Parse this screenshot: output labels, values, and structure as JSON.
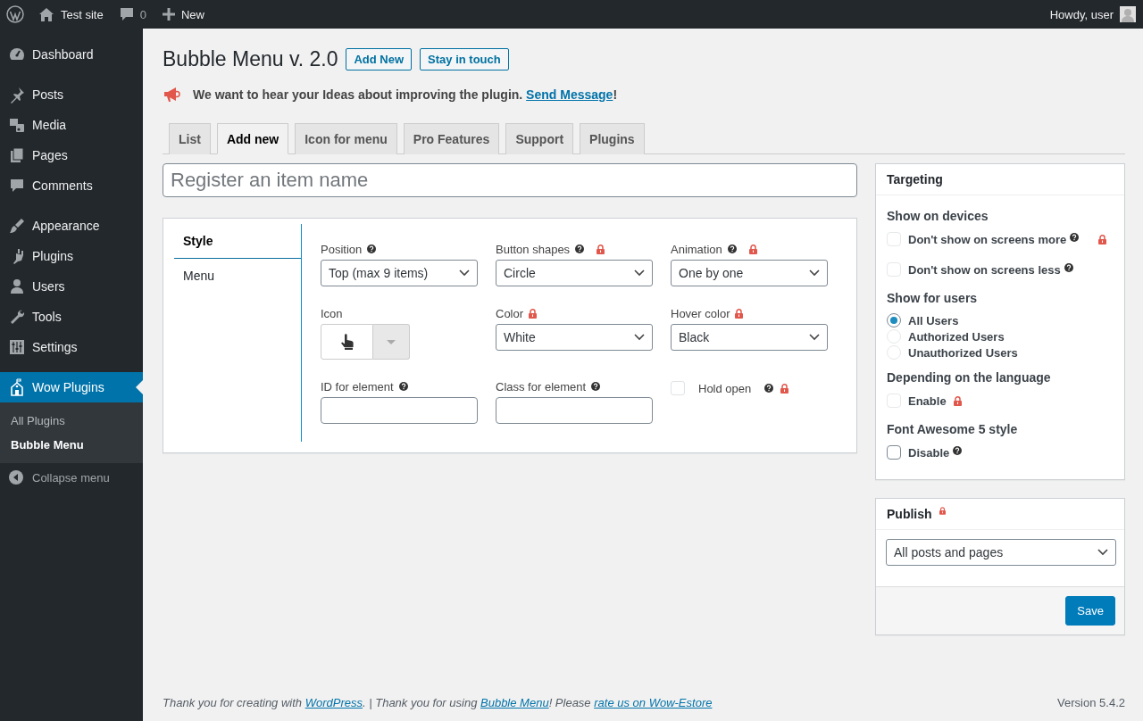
{
  "admin_bar": {
    "site": "Test site",
    "comments": "0",
    "new": "New",
    "greeting": "Howdy, user"
  },
  "sidebar": {
    "groups": [
      [
        {
          "label": "Dashboard",
          "selected": false
        }
      ],
      [
        {
          "label": "Posts",
          "selected": false
        },
        {
          "label": "Media",
          "selected": false
        },
        {
          "label": "Pages",
          "selected": false
        },
        {
          "label": "Comments",
          "selected": false
        }
      ],
      [
        {
          "label": "Appearance",
          "selected": false
        },
        {
          "label": "Plugins",
          "selected": false
        },
        {
          "label": "Users",
          "selected": false
        },
        {
          "label": "Tools",
          "selected": false
        },
        {
          "label": "Settings",
          "selected": false
        }
      ],
      [
        {
          "label": "Wow Plugins",
          "selected": true
        }
      ]
    ],
    "submenu": [
      {
        "label": "All Plugins",
        "selected": false
      },
      {
        "label": "Bubble Menu",
        "selected": true
      }
    ],
    "collapse": "Collapse menu"
  },
  "page": {
    "title": "Bubble Menu v. 2.0",
    "buttons": [
      "Add New",
      "Stay in touch"
    ],
    "notice": {
      "before": "We want to hear your Ideas about improving the plugin. ",
      "link": "Send Message",
      "after": "!"
    }
  },
  "tabs": [
    {
      "label": "List",
      "selected": false
    },
    {
      "label": "Add new",
      "selected": true
    },
    {
      "label": "Icon for menu",
      "selected": false
    },
    {
      "label": "Pro Features",
      "selected": false
    },
    {
      "label": "Support",
      "selected": false
    },
    {
      "label": "Plugins",
      "selected": false
    }
  ],
  "name_field": {
    "placeholder": "Register an item name"
  },
  "settings": {
    "side_tabs": [
      {
        "label": "Style",
        "selected": true
      },
      {
        "label": "Menu",
        "selected": false
      }
    ],
    "fields": [
      {
        "kind": "select",
        "label": "Position",
        "value": "Top (max 9 items)",
        "help": true,
        "locked": false
      },
      {
        "kind": "select",
        "label": "Button shapes",
        "value": "Circle",
        "help": true,
        "locked": true
      },
      {
        "kind": "select",
        "label": "Animation",
        "value": "One by one",
        "help": true,
        "locked": true
      },
      {
        "kind": "icon_picker",
        "label": "Icon",
        "help": false,
        "locked": false
      },
      {
        "kind": "select",
        "label": "Color",
        "value": "White",
        "help": false,
        "locked": true
      },
      {
        "kind": "select",
        "label": "Hover color",
        "value": "Black",
        "help": false,
        "locked": true
      },
      {
        "kind": "text",
        "label": "ID for element",
        "help": true,
        "locked": false
      },
      {
        "kind": "text",
        "label": "Class for element",
        "help": true,
        "locked": false
      },
      {
        "kind": "checkbox",
        "label": "Hold open",
        "checked": false,
        "help": true,
        "locked": true
      }
    ]
  },
  "targeting": {
    "title": "Targeting",
    "sections": [
      {
        "heading": "Show on devices",
        "options": [
          {
            "kind": "checkbox",
            "label": "Don't show on screens more",
            "checked": false,
            "disabled": true,
            "help": true,
            "locked": true
          },
          {
            "kind": "checkbox",
            "label": "Don't show on screens less",
            "checked": false,
            "disabled": true,
            "help": true,
            "locked": false
          }
        ]
      },
      {
        "heading": "Show for users",
        "options": [
          {
            "kind": "radio",
            "label": "All Users",
            "selected": true
          },
          {
            "kind": "radio",
            "label": "Authorized Users",
            "selected": false
          },
          {
            "kind": "radio",
            "label": "Unauthorized Users",
            "selected": false
          }
        ]
      },
      {
        "heading": "Depending on the language",
        "options": [
          {
            "kind": "checkbox",
            "label": "Enable",
            "checked": false,
            "disabled": true,
            "help": false,
            "locked": true
          }
        ]
      },
      {
        "heading": "Font Awesome 5 style",
        "options": [
          {
            "kind": "checkbox",
            "label": "Disable",
            "checked": false,
            "disabled": false,
            "help": true,
            "locked": false
          }
        ]
      }
    ]
  },
  "publish": {
    "title": "Publish",
    "locked": true,
    "value": "All posts and pages",
    "button": "Save"
  },
  "footer": {
    "parts": [
      {
        "kind": "text",
        "text": "Thank you for creating with "
      },
      {
        "kind": "link",
        "text": "WordPress"
      },
      {
        "kind": "text",
        "text": ". | Thank you for using "
      },
      {
        "kind": "link",
        "text": "Bubble Menu"
      },
      {
        "kind": "text",
        "text": "! Please "
      },
      {
        "kind": "link",
        "text": "rate us on Wow-Estore"
      }
    ],
    "version": "Version 5.4.2"
  }
}
